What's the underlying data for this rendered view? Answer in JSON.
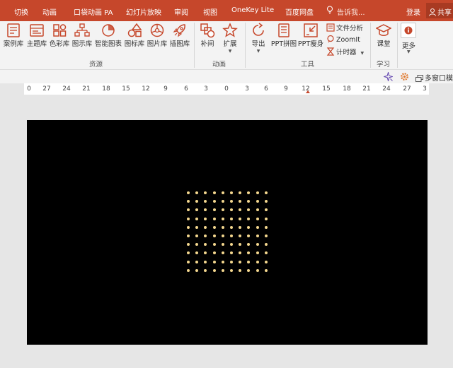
{
  "tabs": [
    {
      "label": "切换"
    },
    {
      "label": "动画"
    },
    {
      "label": "口袋动画 PA"
    },
    {
      "label": "幻灯片放映"
    },
    {
      "label": "审阅"
    },
    {
      "label": "视图"
    },
    {
      "label": "OneKey Lite"
    },
    {
      "label": "百度网盘"
    }
  ],
  "search": {
    "placeholder": "告诉我..."
  },
  "account": {
    "login": "登录",
    "share": "共享"
  },
  "ribbon": {
    "resources": {
      "items": [
        {
          "label": "案例库",
          "icon": "case-library-icon"
        },
        {
          "label": "主题库",
          "icon": "theme-library-icon"
        },
        {
          "label": "色彩库",
          "icon": "color-library-icon"
        },
        {
          "label": "图示库",
          "icon": "diagram-library-icon"
        },
        {
          "label": "智能图表",
          "icon": "smart-chart-icon"
        },
        {
          "label": "图标库",
          "icon": "icon-library-icon"
        },
        {
          "label": "图片库",
          "icon": "picture-library-icon"
        },
        {
          "label": "插图库",
          "icon": "illustration-library-icon"
        }
      ],
      "group_label": "资源"
    },
    "animation": {
      "tween": "补间",
      "extend": "扩展",
      "group_label": "动画"
    },
    "tools": {
      "export": "导出",
      "ppt_merge": "PPT拼图",
      "ppt_slim": "PPT瘦身",
      "file_analysis": "文件分析",
      "zoomit": "ZoomIt",
      "timer": "计时器",
      "group_label": "工具"
    },
    "learn": {
      "classroom": "课堂",
      "group_label": "学习"
    },
    "more": {
      "label": "更多"
    }
  },
  "strip": {
    "multi_window": "多窗口模式"
  },
  "ruler": {
    "ticks": [
      "0",
      "27",
      "24",
      "21",
      "18",
      "15",
      "12",
      "9",
      "6",
      "3",
      "0",
      "3",
      "6",
      "9",
      "12",
      "15",
      "18",
      "21",
      "24",
      "27",
      "3"
    ]
  },
  "slide": {
    "background": "#000000",
    "dot_color": "#f4d78e",
    "dot_rows": 10,
    "dot_cols": 10
  },
  "colors": {
    "accent": "#c6472b"
  }
}
